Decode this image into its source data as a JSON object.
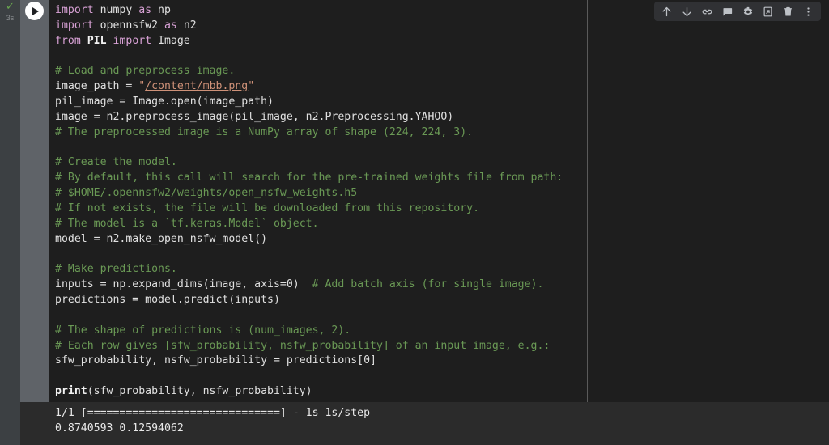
{
  "cell": {
    "status_icon": "check-icon",
    "execution_time": "3s",
    "run_icon": "play-icon"
  },
  "toolbar": {
    "buttons": [
      {
        "name": "move-cell-up-button",
        "icon": "arrow-up-icon",
        "label": "Move cell up"
      },
      {
        "name": "move-cell-down-button",
        "icon": "arrow-down-icon",
        "label": "Move cell down"
      },
      {
        "name": "link-to-cell-button",
        "icon": "link-icon",
        "label": "Link to cell"
      },
      {
        "name": "add-comment-button",
        "icon": "comment-icon",
        "label": "Add comment"
      },
      {
        "name": "cell-settings-button",
        "icon": "gear-icon",
        "label": "Settings"
      },
      {
        "name": "mirror-cell-button",
        "icon": "open-in-new-icon",
        "label": "Mirror cell in tab"
      },
      {
        "name": "delete-cell-button",
        "icon": "trash-icon",
        "label": "Delete cell"
      },
      {
        "name": "more-options-button",
        "icon": "more-vert-icon",
        "label": "More cell actions"
      }
    ]
  },
  "code": {
    "lines": [
      [
        {
          "t": "import",
          "c": "k"
        },
        {
          "t": " numpy ",
          "c": "nm"
        },
        {
          "t": "as",
          "c": "k"
        },
        {
          "t": " np",
          "c": "nm"
        }
      ],
      [
        {
          "t": "import",
          "c": "k"
        },
        {
          "t": " opennsfw2 ",
          "c": "nm"
        },
        {
          "t": "as",
          "c": "k"
        },
        {
          "t": " n2",
          "c": "nm"
        }
      ],
      [
        {
          "t": "from",
          "c": "k"
        },
        {
          "t": " ",
          "c": "nm"
        },
        {
          "t": "PIL",
          "c": "bi"
        },
        {
          "t": " ",
          "c": "nm"
        },
        {
          "t": "import",
          "c": "k"
        },
        {
          "t": " Image",
          "c": "nm"
        }
      ],
      [],
      [
        {
          "t": "# Load and preprocess image.",
          "c": "cm"
        }
      ],
      [
        {
          "t": "image_path = ",
          "c": "nm"
        },
        {
          "t": "\"",
          "c": "st2"
        },
        {
          "t": "/content/mbb.png",
          "c": "st"
        },
        {
          "t": "\"",
          "c": "st2"
        }
      ],
      [
        {
          "t": "pil_image = Image.open(image_path)",
          "c": "nm"
        }
      ],
      [
        {
          "t": "image = n2.preprocess_image(pil_image, n2.Preprocessing.YAHOO)",
          "c": "nm"
        }
      ],
      [
        {
          "t": "# The preprocessed image is a NumPy array of shape (224, 224, 3).",
          "c": "cm"
        }
      ],
      [],
      [
        {
          "t": "# Create the model.",
          "c": "cm"
        }
      ],
      [
        {
          "t": "# By default, this call will search for the pre-trained weights file from path:",
          "c": "cm"
        }
      ],
      [
        {
          "t": "# $HOME/.opennsfw2/weights/open_nsfw_weights.h5",
          "c": "cm"
        }
      ],
      [
        {
          "t": "# If not exists, the file will be downloaded from this repository.",
          "c": "cm"
        }
      ],
      [
        {
          "t": "# The model is a `tf.keras.Model` object.",
          "c": "cm"
        }
      ],
      [
        {
          "t": "model = n2.make_open_nsfw_model()",
          "c": "nm"
        }
      ],
      [],
      [
        {
          "t": "# Make predictions.",
          "c": "cm"
        }
      ],
      [
        {
          "t": "inputs = np.expand_dims(image, axis=0)  ",
          "c": "nm"
        },
        {
          "t": "# Add batch axis (for single image).",
          "c": "cm"
        }
      ],
      [
        {
          "t": "predictions = model.predict(inputs)",
          "c": "nm"
        }
      ],
      [],
      [
        {
          "t": "# The shape of predictions is (num_images, 2).",
          "c": "cm"
        }
      ],
      [
        {
          "t": "# Each row gives [sfw_probability, nsfw_probability] of an input image, e.g.:",
          "c": "cm"
        }
      ],
      [
        {
          "t": "sfw_probability, nsfw_probability = predictions[0]",
          "c": "nm"
        }
      ],
      [],
      [
        {
          "t": "print",
          "c": "bi"
        },
        {
          "t": "(sfw_probability, nsfw_probability)",
          "c": "nm"
        }
      ]
    ]
  },
  "output": {
    "lines": [
      "1/1 [==============================] - 1s 1s/step",
      "0.8740593 0.12594062"
    ],
    "progress_total": "1/1",
    "progress_bar_chars": 30,
    "elapsed": "1s",
    "per_step": "1s/step",
    "sfw_probability": "0.8740593",
    "nsfw_probability": "0.12594062"
  },
  "colors": {
    "code_background": "#1e1e1e",
    "output_background": "#2b2b2b",
    "gutter_status": "#3c4043",
    "gutter_run": "#5f6368",
    "toolbar_background": "#303134",
    "keyword": "#d9a2d6",
    "comment": "#6a9955",
    "string": "#ce9178",
    "plain_text": "#d4d4d4",
    "status_check": "#6aa84f"
  }
}
